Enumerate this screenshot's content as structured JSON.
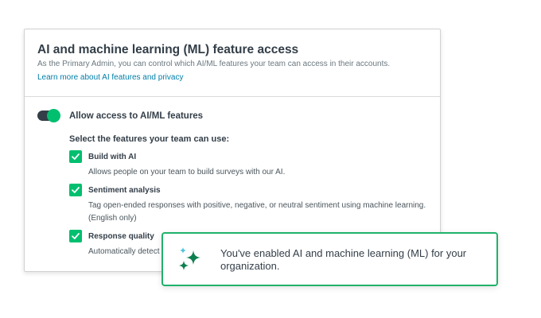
{
  "panel": {
    "title": "AI and machine learning (ML) feature access",
    "subtitle": "As the Primary Admin, you can control which AI/ML features your team can access in their accounts.",
    "learn_link": "Learn more about AI features and privacy"
  },
  "master_toggle": {
    "label": "Allow access to AI/ML features",
    "state": "on"
  },
  "features_heading": "Select the features your team can use:",
  "features": [
    {
      "name": "Build with AI",
      "checked": true,
      "desc": [
        "Allows people on your team to build surveys with our AI."
      ]
    },
    {
      "name": "Sentiment analysis",
      "checked": true,
      "desc": [
        "Tag open-ended responses with positive, negative, or neutral sentiment using machine learning.",
        "(English only)"
      ]
    },
    {
      "name": "Response quality",
      "checked": true,
      "desc": [
        "Automatically detect p"
      ]
    }
  ],
  "toast": {
    "message": "You've enabled AI and machine learning (ML) for your organization.",
    "icon": "sparkle-icon"
  },
  "colors": {
    "accent_green": "#00bf6f",
    "toast_border": "#1fb26b",
    "link_blue": "#007faa",
    "text_dark": "#333e48",
    "toggle_track": "#333e48"
  }
}
